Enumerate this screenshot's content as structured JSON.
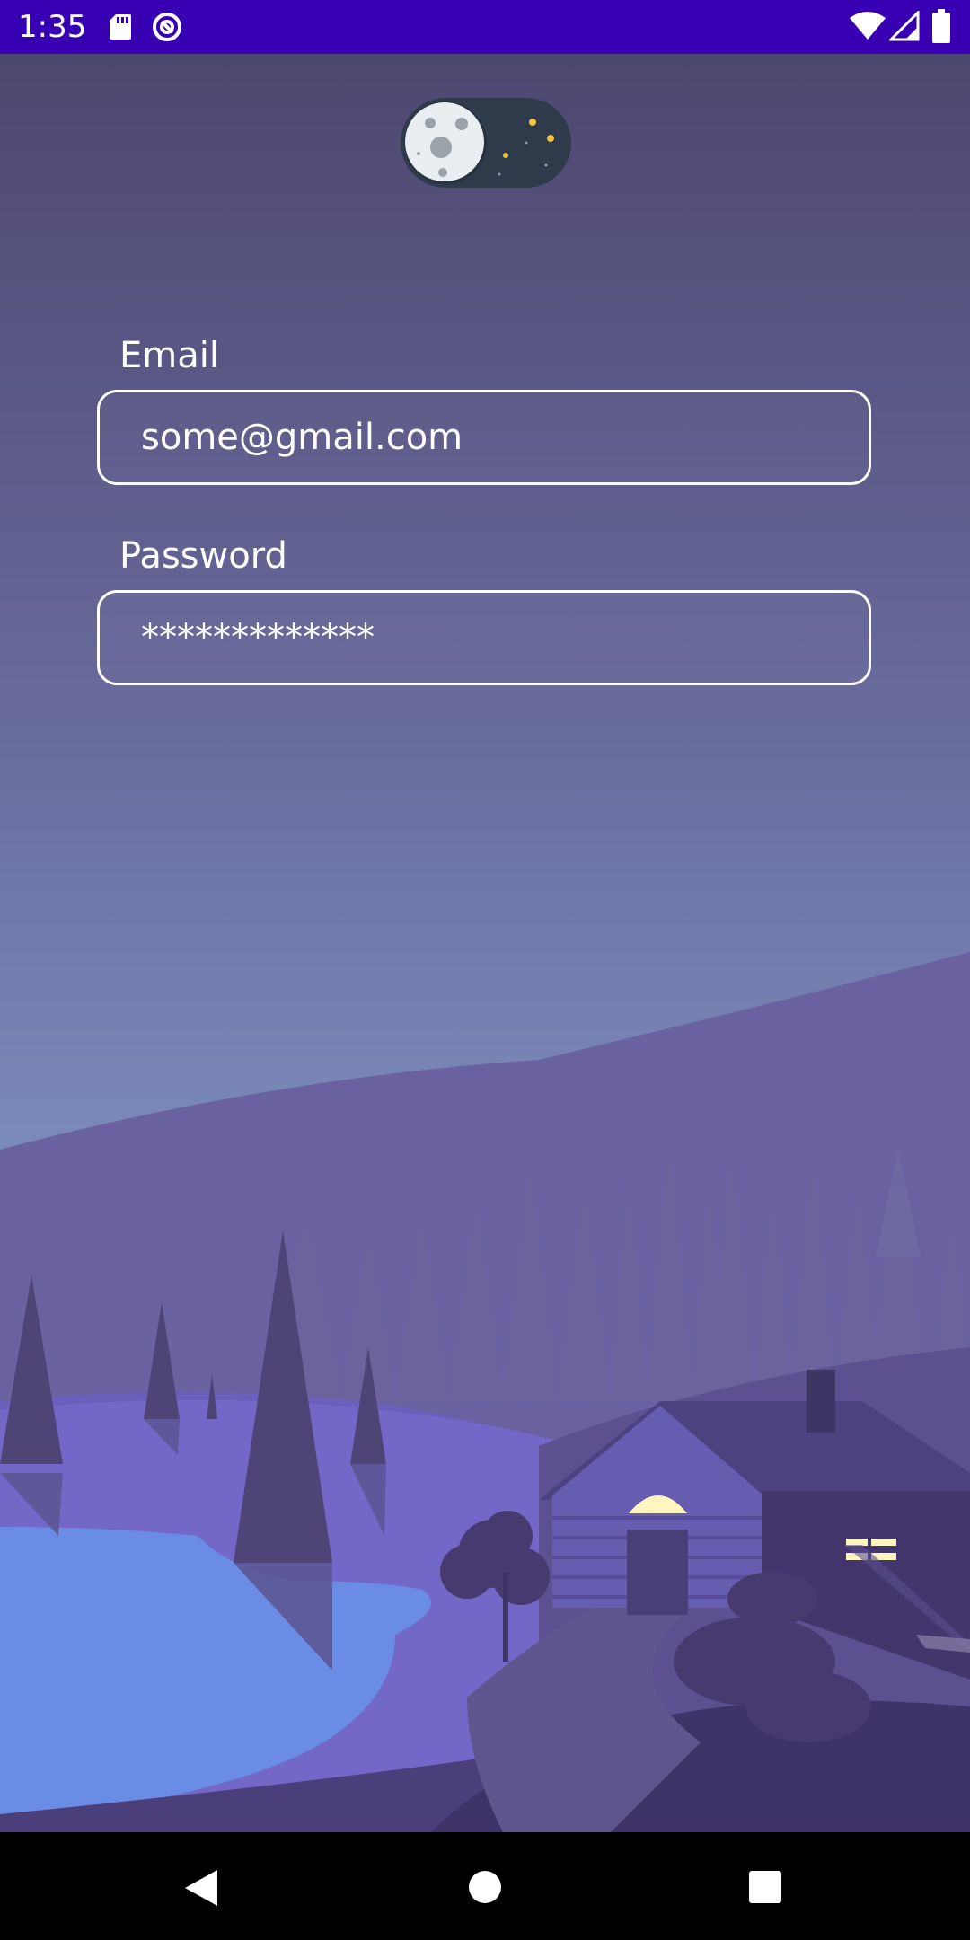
{
  "status_bar": {
    "time": "1:35",
    "icons": [
      "sd-card-icon",
      "sync-icon",
      "wifi-icon",
      "cell-signal-icon",
      "battery-icon"
    ]
  },
  "theme_toggle": {
    "state": "dark",
    "icon": "moon-icon"
  },
  "form": {
    "email": {
      "label": "Email",
      "value": "some@gmail.com"
    },
    "password": {
      "label": "Password",
      "value": "*************"
    }
  },
  "nav_bar": {
    "icons": [
      "back-icon",
      "home-icon",
      "recents-icon"
    ]
  },
  "colors": {
    "status_bar": "#3700b3",
    "sky_top": "#4d4870",
    "sky_bottom": "#8193c0",
    "lake": "#6b8ce5",
    "window_light": "#fff6bf"
  }
}
